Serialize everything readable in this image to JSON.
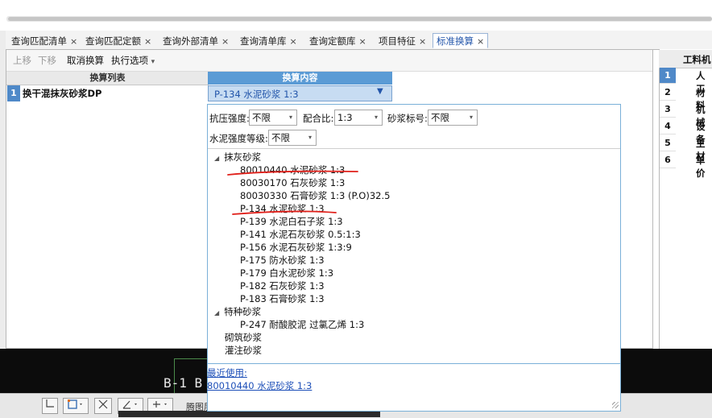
{
  "tabs": [
    {
      "label": "查询匹配清单",
      "close": "×"
    },
    {
      "label": "查询匹配定额",
      "close": "×"
    },
    {
      "label": "查询外部清单",
      "close": "×"
    },
    {
      "label": "查询清单库",
      "close": "×"
    },
    {
      "label": "查询定额库",
      "close": "×"
    },
    {
      "label": "项目特征",
      "close": "×"
    },
    {
      "label": "标准换算",
      "close": "×",
      "active": true
    }
  ],
  "toolbar": {
    "move_up": "上移",
    "move_down": "下移",
    "cancel_conversion": "取消换算",
    "exec_options": "执行选项",
    "exec_options_arrow": "▾"
  },
  "grid": {
    "col_list": "换算列表",
    "col_content": "换算内容",
    "rows": [
      {
        "num": "1",
        "name": "换干混抹灰砂浆DP",
        "value": "P-134  水泥砂浆 1:3",
        "arrow": "▼"
      }
    ]
  },
  "filters": {
    "strength_label": "抗压强度:",
    "strength_value": "不限",
    "ratio_label": "配合比:",
    "ratio_value": "1:3",
    "mortar_grade_label": "砂浆标号:",
    "mortar_grade_value": "不限",
    "cement_grade_label": "水泥强度等级:",
    "cement_grade_value": "不限",
    "arrow": "▾"
  },
  "tree": {
    "groups": [
      {
        "label": "抹灰砂浆",
        "toggle": "◢",
        "items": [
          "80010440  水泥砂浆 1:3",
          "80030170  石灰砂浆 1:3",
          "80030330  石膏砂浆 1:3 (P.O)32.5",
          "P-134  水泥砂浆 1:3",
          "P-139  水泥白石子浆 1:3",
          "P-141  水泥石灰砂浆 0.5:1:3",
          "P-156  水泥石灰砂浆 1:3:9",
          "P-175  防水砂浆 1:3",
          "P-179  白水泥砂浆 1:3",
          "P-182  石灰砂浆 1:3",
          "P-183  石膏砂浆 1:3"
        ]
      },
      {
        "label": "特种砂浆",
        "toggle": "◢",
        "items": [
          "P-247  耐酸胶泥 过氯乙烯 1:3"
        ]
      }
    ],
    "leaf_groups": [
      "砌筑砂浆",
      "灌注砂浆"
    ]
  },
  "recent": {
    "label": "最近使用:",
    "item": "80010440 水泥砂浆 1:3"
  },
  "right_panel": {
    "header": "工料机",
    "rows": [
      {
        "num": "1",
        "label": "人工",
        "selected": true
      },
      {
        "num": "2",
        "label": "材料"
      },
      {
        "num": "3",
        "label": "机械"
      },
      {
        "num": "4",
        "label": "设备"
      },
      {
        "num": "5",
        "label": "主材"
      },
      {
        "num": "6",
        "label": "单价"
      }
    ]
  },
  "cad": {
    "text": "B-1 B"
  },
  "bottom_bar": {
    "text": "腾图层"
  },
  "colors": {
    "accent": "#4f89c8",
    "annotation_red": "#e0201a",
    "link": "#1d4fb8"
  }
}
